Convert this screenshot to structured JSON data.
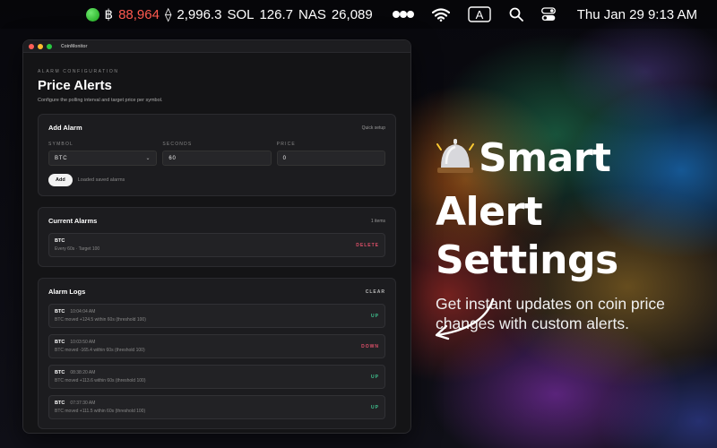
{
  "menubar": {
    "ticker": [
      {
        "symbol": "฿",
        "value": "88,964",
        "color": "#ff5a4f"
      },
      {
        "symbol": "⟠",
        "value": "2,996.3",
        "color": "#ffffff"
      },
      {
        "symbol": "SOL",
        "value": "126.7",
        "color": "#ffffff"
      },
      {
        "symbol": "NAS",
        "value": "26,089",
        "color": "#ffffff"
      }
    ],
    "datetime": "Thu Jan 29  9:13 AM",
    "icons": [
      "status-dot-icon",
      "overflow-dots-icon",
      "wifi-icon",
      "input-source-icon",
      "search-icon",
      "control-center-icon"
    ],
    "input_source_label": "A"
  },
  "window": {
    "title": "CoinMonitor",
    "overline": "ALARM CONFIGURATION",
    "page_title": "Price Alerts",
    "page_subtitle": "Configure the polling interval and target price per symbol.",
    "add_alarm": {
      "title": "Add Alarm",
      "aux": "Quick setup",
      "symbol_label": "SYMBOL",
      "symbol_value": "BTC",
      "seconds_label": "SECONDS",
      "seconds_value": "60",
      "price_label": "PRICE",
      "price_value": "0",
      "add_button": "Add",
      "status": "Loaded saved alarms"
    },
    "current_alarms": {
      "title": "Current Alarms",
      "count": "1 items",
      "items": [
        {
          "symbol": "BTC",
          "detail": "Every 60s · Target 100",
          "action": "DELETE"
        }
      ]
    },
    "alarm_logs": {
      "title": "Alarm Logs",
      "clear": "CLEAR",
      "items": [
        {
          "symbol": "BTC",
          "time": "10:04:04 AM",
          "detail": "BTC moved +124.5 within 60s (threshold 100)",
          "direction": "UP"
        },
        {
          "symbol": "BTC",
          "time": "10:03:50 AM",
          "detail": "BTC moved -165.4 within 60s (threshold 100)",
          "direction": "DOWN"
        },
        {
          "symbol": "BTC",
          "time": "08:38:20 AM",
          "detail": "BTC moved +113.6 within 60s (threshold 100)",
          "direction": "UP"
        },
        {
          "symbol": "BTC",
          "time": "07:37:30 AM",
          "detail": "BTC moved +111.5 within 60s (threshold 100)",
          "direction": "UP"
        }
      ]
    }
  },
  "promo": {
    "title_line1": "Smart",
    "title_line2": "Alert Settings",
    "subtitle": "Get instant updates on coin price changes with custom alerts."
  },
  "colors": {
    "up": "#3fc28f",
    "down": "#e0506a",
    "accent_red": "#ff5a4f"
  }
}
